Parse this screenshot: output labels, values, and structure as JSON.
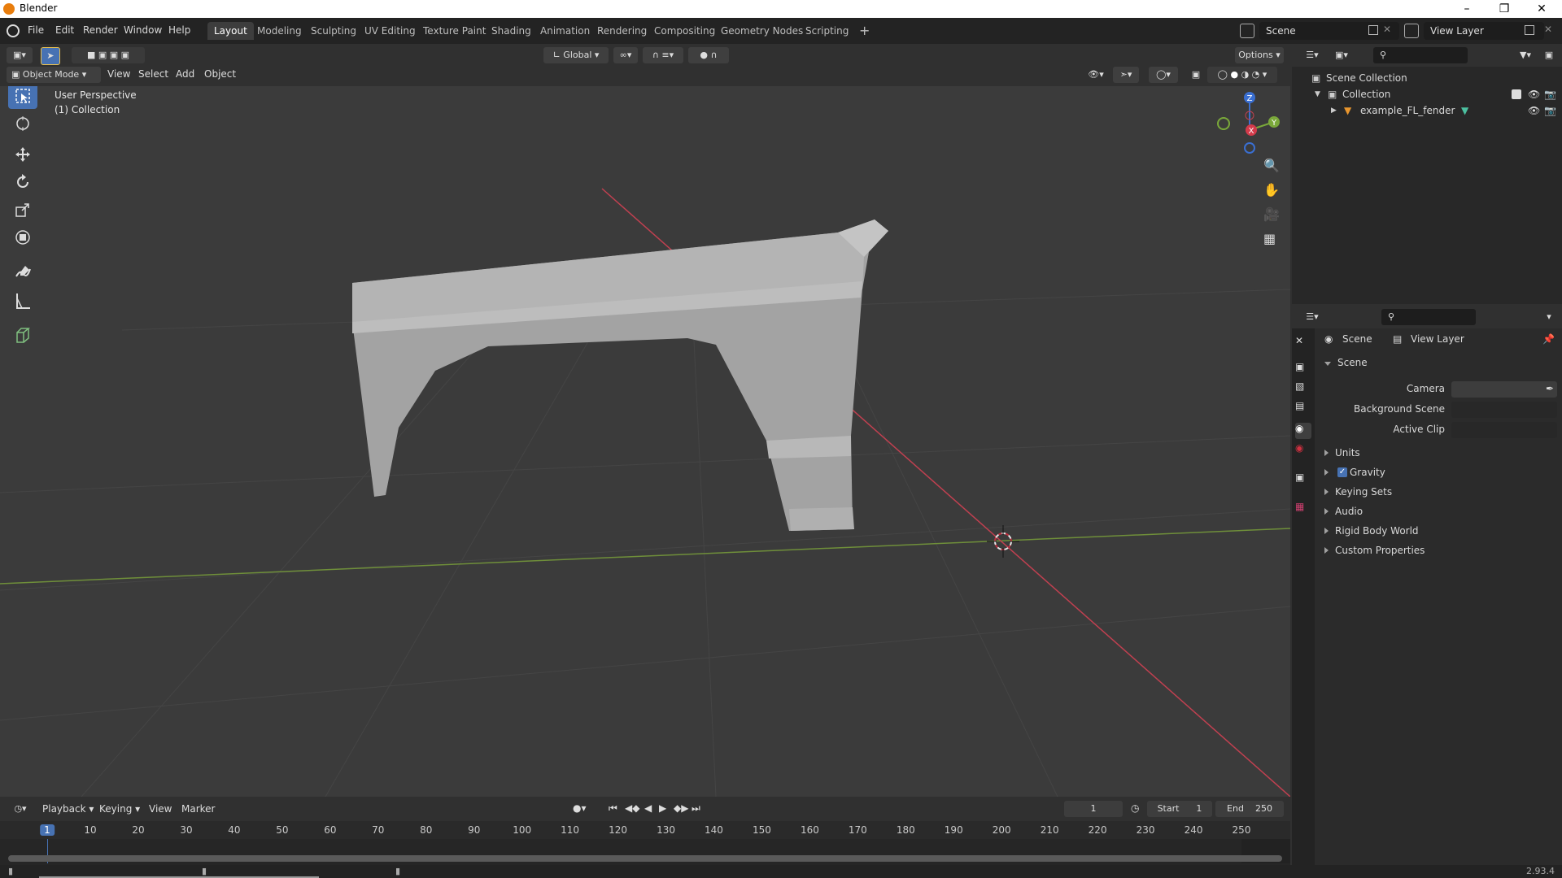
{
  "app": {
    "title": "Blender",
    "version": "2.93.4"
  },
  "menu": [
    "File",
    "Edit",
    "Render",
    "Window",
    "Help"
  ],
  "workspaces": [
    "Layout",
    "Modeling",
    "Sculpting",
    "UV Editing",
    "Texture Paint",
    "Shading",
    "Animation",
    "Rendering",
    "Compositing",
    "Geometry Nodes",
    "Scripting"
  ],
  "active_workspace": "Layout",
  "scene_name": "Scene",
  "view_layer_name": "View Layer",
  "viewport": {
    "transform_orientation": "Global",
    "options_label": "Options",
    "mode": "Object Mode",
    "header_menus": [
      "View",
      "Select",
      "Add",
      "Object"
    ],
    "perspective_label": "User Perspective",
    "collection_label": "(1) Collection"
  },
  "tools": [
    "select-box-icon",
    "cursor-icon",
    "move-icon",
    "rotate-icon",
    "scale-icon",
    "transform-icon",
    "annotate-icon",
    "measure-icon",
    "add-cube-icon"
  ],
  "outliner": {
    "scene_collection": "Scene Collection",
    "collection": "Collection",
    "object": "example_FL_fender"
  },
  "properties": {
    "breadcrumb_scene": "Scene",
    "breadcrumb_view_layer": "View Layer",
    "panel_title": "Scene",
    "fields": [
      {
        "label": "Camera"
      },
      {
        "label": "Background Scene"
      },
      {
        "label": "Active Clip"
      }
    ],
    "sections": [
      "Units",
      "Gravity",
      "Keying Sets",
      "Audio",
      "Rigid Body World",
      "Custom Properties"
    ],
    "gravity_checked": true
  },
  "timeline": {
    "menus": [
      "Playback",
      "Keying",
      "View",
      "Marker"
    ],
    "current_frame": "1",
    "start_label": "Start",
    "start_value": "1",
    "end_label": "End",
    "end_value": "250",
    "ticks": [
      "1",
      "10",
      "20",
      "30",
      "40",
      "50",
      "60",
      "70",
      "80",
      "90",
      "100",
      "110",
      "120",
      "130",
      "140",
      "150",
      "160",
      "170",
      "180",
      "190",
      "200",
      "210",
      "220",
      "230",
      "240",
      "250"
    ]
  },
  "colors": {
    "accent": "#4772b3",
    "x_axis": "#d23a4a",
    "y_axis": "#7aa83a",
    "z_axis": "#3a6fd2"
  }
}
